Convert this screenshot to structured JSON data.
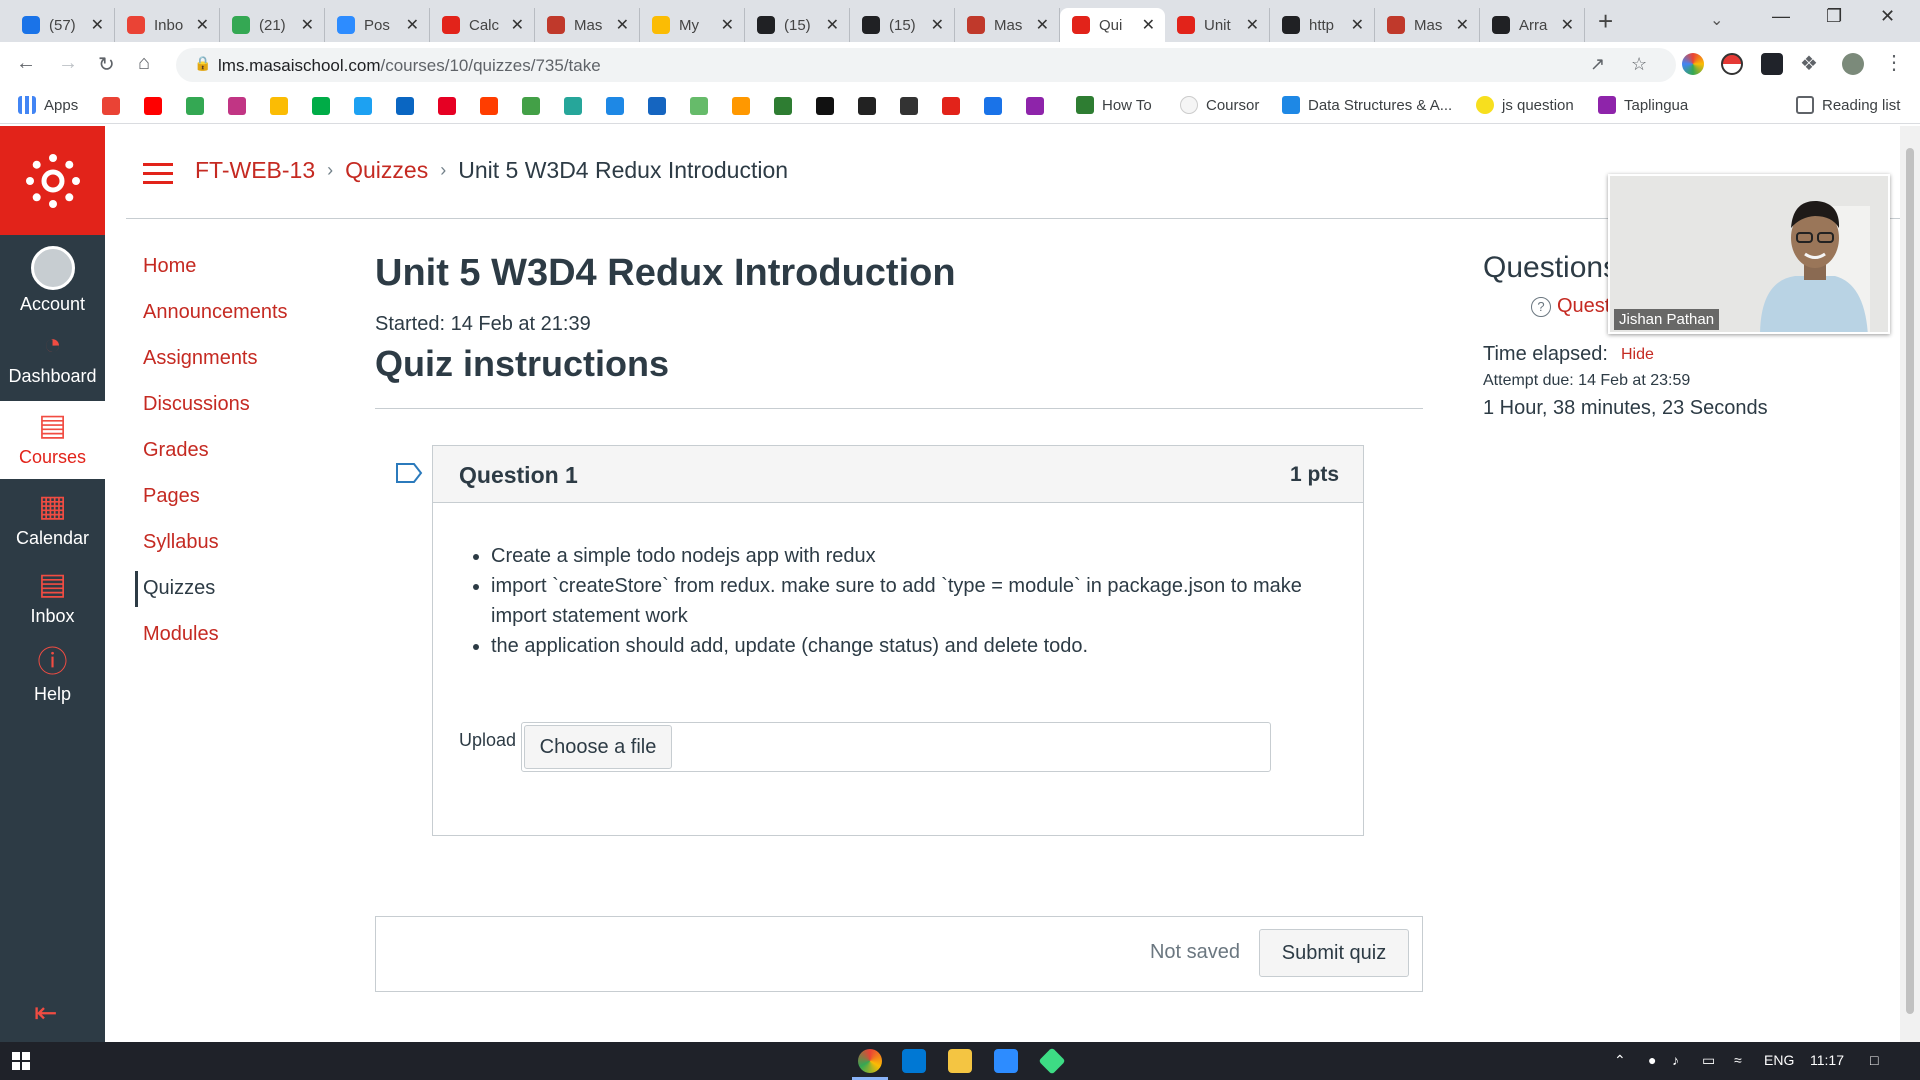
{
  "browser": {
    "tabs": [
      {
        "title": "(57)",
        "color": "#1a73e8"
      },
      {
        "title": "Inbo",
        "color": "#ea4335"
      },
      {
        "title": "(21)",
        "color": "#34a853"
      },
      {
        "title": "Pos",
        "color": "#2d8cff"
      },
      {
        "title": "Calc",
        "color": "#e2231a"
      },
      {
        "title": "Mas",
        "color": "#c0392b"
      },
      {
        "title": "My",
        "color": "#fbbc04"
      },
      {
        "title": "(15)",
        "color": "#202124"
      },
      {
        "title": "(15)",
        "color": "#202124"
      },
      {
        "title": "Mas",
        "color": "#c0392b"
      },
      {
        "title": "Qui",
        "color": "#e2231a",
        "active": true
      },
      {
        "title": "Unit",
        "color": "#e2231a"
      },
      {
        "title": "http",
        "color": "#202124"
      },
      {
        "title": "Mas",
        "color": "#c0392b"
      },
      {
        "title": "Arra",
        "color": "#202124"
      }
    ],
    "url_domain": "lms.masaischool.com",
    "url_path": "/courses/10/quizzes/735/take",
    "bookmarks": [
      {
        "label": "Apps",
        "icon": "apps-grid-icon"
      },
      {
        "label": "How To",
        "icon": "w-icon"
      },
      {
        "label": "Coursor",
        "icon": "coursor-icon"
      },
      {
        "label": "Data Structures & A...",
        "icon": "udemy-icon"
      },
      {
        "label": "js question",
        "icon": "js-icon"
      },
      {
        "label": "Taplingua",
        "icon": "star-icon"
      }
    ],
    "reading_list": "Reading list"
  },
  "global_nav": {
    "items": [
      {
        "label": "Account",
        "icon": "user-avatar-icon"
      },
      {
        "label": "Dashboard",
        "icon": "dashboard-icon"
      },
      {
        "label": "Courses",
        "icon": "courses-icon",
        "active": true
      },
      {
        "label": "Calendar",
        "icon": "calendar-icon"
      },
      {
        "label": "Inbox",
        "icon": "inbox-icon"
      },
      {
        "label": "Help",
        "icon": "help-icon"
      }
    ]
  },
  "breadcrumb": {
    "course": "FT-WEB-13",
    "section": "Quizzes",
    "current": "Unit 5 W3D4 Redux Introduction"
  },
  "course_nav": {
    "items": [
      {
        "label": "Home"
      },
      {
        "label": "Announcements"
      },
      {
        "label": "Assignments"
      },
      {
        "label": "Discussions"
      },
      {
        "label": "Grades"
      },
      {
        "label": "Pages"
      },
      {
        "label": "Syllabus"
      },
      {
        "label": "Quizzes",
        "active": true
      },
      {
        "label": "Modules"
      }
    ]
  },
  "quiz": {
    "title": "Unit 5 W3D4 Redux Introduction",
    "started": "Started: 14 Feb at 21:39",
    "instructions_heading": "Quiz instructions",
    "question": {
      "name": "Question 1",
      "points": "1 pts",
      "bullets": [
        "Create a simple todo nodejs app with redux",
        "import `createStore` from redux. make sure to add `type = module` in package.json to make import statement work",
        "the application should add, update (change status) and delete todo."
      ],
      "upload_label": "Upload",
      "choose_file": "Choose a file"
    },
    "status": "Not saved",
    "submit_label": "Submit quiz"
  },
  "sidebar": {
    "title": "Questions",
    "question_link": "Question 1",
    "time_label": "Time elapsed:",
    "hide_label": "Hide",
    "attempt_due": "Attempt due: 14 Feb at 23:59",
    "elapsed": "1 Hour, 38 minutes, 23 Seconds"
  },
  "webcam": {
    "name": "Jishan Pathan"
  },
  "taskbar": {
    "language": "ENG",
    "time": "11:17"
  }
}
